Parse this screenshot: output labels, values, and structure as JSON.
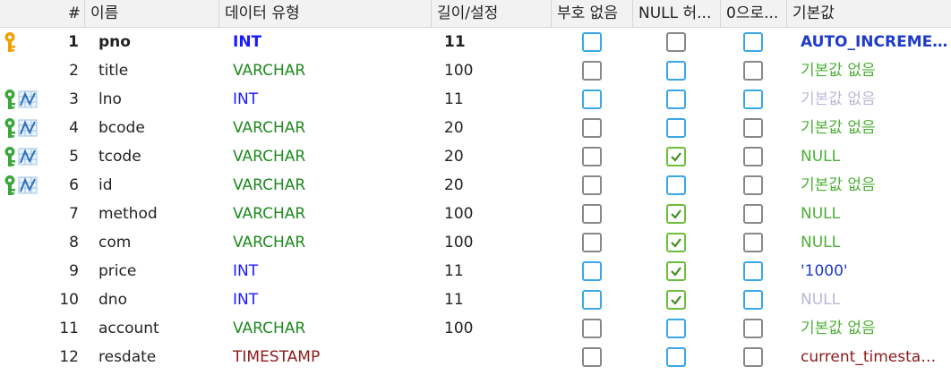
{
  "header": {
    "num": "#",
    "name": "이름",
    "type": "데이터 유형",
    "length": "길이/설정",
    "unsigned": "부호 없음",
    "allow_null": "NULL 허...",
    "zerofill": "0으로...",
    "default": "기본값"
  },
  "colors": {
    "int": "#1a1aff",
    "varchar": "#1e8a1e",
    "timestamp": "#8b1a1a",
    "default_green": "#4caf35",
    "default_muted": "#b8b8d8",
    "default_blue": "#1f3cc8",
    "checkbox_gray": "#888888",
    "checkbox_blue": "#3aa7e8",
    "checkbox_green": "#6cbf3c",
    "primary_key": "#f0a000",
    "foreign_key": "#3ca63c"
  },
  "rows": [
    {
      "num": "1",
      "name": "pno",
      "type": "INT",
      "type_class": "int",
      "length": "11",
      "unsigned": "blue",
      "allow_null": "gray",
      "zerofill": "blue",
      "default": "AUTO_INCREMENT",
      "default_class": "default_blue",
      "icons": [
        "primary-key-icon"
      ],
      "bold": true
    },
    {
      "num": "2",
      "name": "title",
      "type": "VARCHAR",
      "type_class": "varchar",
      "length": "100",
      "unsigned": "gray",
      "allow_null": "blue",
      "zerofill": "gray",
      "default": "기본값 없음",
      "default_class": "default_green",
      "icons": []
    },
    {
      "num": "3",
      "name": "lno",
      "type": "INT",
      "type_class": "int",
      "length": "11",
      "unsigned": "blue",
      "allow_null": "blue",
      "zerofill": "blue",
      "default": "기본값 없음",
      "default_class": "default_muted",
      "icons": [
        "foreign-key-icon",
        "index-icon"
      ]
    },
    {
      "num": "4",
      "name": "bcode",
      "type": "VARCHAR",
      "type_class": "varchar",
      "length": "20",
      "unsigned": "gray",
      "allow_null": "blue",
      "zerofill": "gray",
      "default": "기본값 없음",
      "default_class": "default_green",
      "icons": [
        "foreign-key-icon",
        "index-icon"
      ]
    },
    {
      "num": "5",
      "name": "tcode",
      "type": "VARCHAR",
      "type_class": "varchar",
      "length": "20",
      "unsigned": "gray",
      "allow_null": "checked",
      "zerofill": "gray",
      "default": "NULL",
      "default_class": "default_green",
      "icons": [
        "foreign-key-icon",
        "index-icon"
      ]
    },
    {
      "num": "6",
      "name": "id",
      "type": "VARCHAR",
      "type_class": "varchar",
      "length": "20",
      "unsigned": "gray",
      "allow_null": "blue",
      "zerofill": "gray",
      "default": "기본값 없음",
      "default_class": "default_green",
      "icons": [
        "foreign-key-icon",
        "index-icon"
      ]
    },
    {
      "num": "7",
      "name": "method",
      "type": "VARCHAR",
      "type_class": "varchar",
      "length": "100",
      "unsigned": "gray",
      "allow_null": "checked",
      "zerofill": "gray",
      "default": "NULL",
      "default_class": "default_green",
      "icons": []
    },
    {
      "num": "8",
      "name": "com",
      "type": "VARCHAR",
      "type_class": "varchar",
      "length": "100",
      "unsigned": "gray",
      "allow_null": "checked",
      "zerofill": "gray",
      "default": "NULL",
      "default_class": "default_green",
      "icons": []
    },
    {
      "num": "9",
      "name": "price",
      "type": "INT",
      "type_class": "int",
      "length": "11",
      "unsigned": "blue",
      "allow_null": "checked",
      "zerofill": "blue",
      "default": "'1000'",
      "default_class": "default_blue",
      "icons": []
    },
    {
      "num": "10",
      "name": "dno",
      "type": "INT",
      "type_class": "int",
      "length": "11",
      "unsigned": "blue",
      "allow_null": "checked",
      "zerofill": "blue",
      "default": "NULL",
      "default_class": "default_muted",
      "icons": []
    },
    {
      "num": "11",
      "name": "account",
      "type": "VARCHAR",
      "type_class": "varchar",
      "length": "100",
      "unsigned": "gray",
      "allow_null": "blue",
      "zerofill": "gray",
      "default": "기본값 없음",
      "default_class": "default_green",
      "icons": []
    },
    {
      "num": "12",
      "name": "resdate",
      "type": "TIMESTAMP",
      "type_class": "timestamp",
      "length": "",
      "unsigned": "gray",
      "allow_null": "blue",
      "zerofill": "gray",
      "default": "current_timestamp()",
      "default_class": "timestamp",
      "icons": []
    }
  ]
}
